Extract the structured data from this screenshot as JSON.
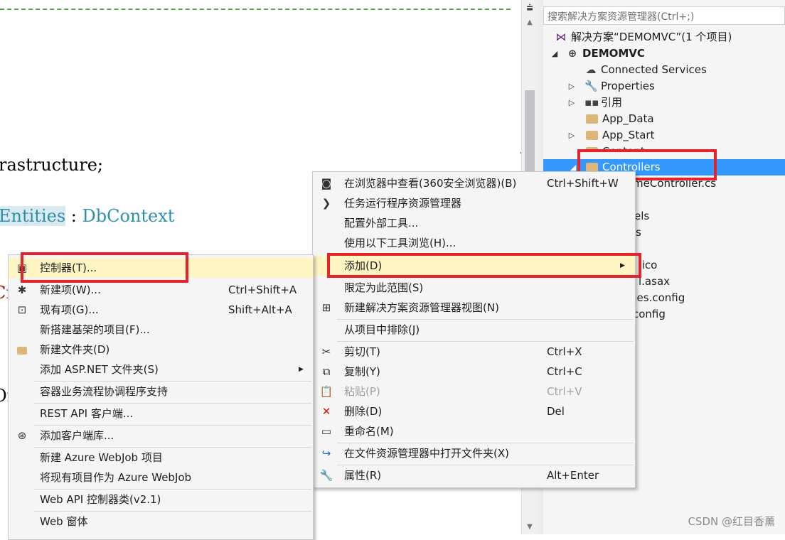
{
  "editor": {
    "line_infra": "rastructure;",
    "line_entities_a": "Entities",
    "line_entities_b": " : ",
    "line_entities_c": "DbContext",
    "frag_cr": "Cr",
    "frag_or": "Or"
  },
  "solution_explorer": {
    "search_placeholder": "搜索解决方案资源管理器(Ctrl+;)",
    "items": [
      {
        "label": "解决方案“DEMOMVC”(1 个项目)"
      },
      {
        "label": "DEMOMVC"
      },
      {
        "label": "Connected Services"
      },
      {
        "label": "Properties"
      },
      {
        "label": "引用"
      },
      {
        "label": "App_Data"
      },
      {
        "label": "App_Start"
      },
      {
        "label": "Content"
      },
      {
        "label": "Controllers"
      },
      {
        "label": "HomeController.cs"
      },
      {
        "label": "Models"
      },
      {
        "label": "Views"
      },
      {
        "label": "favicon.ico"
      },
      {
        "label": "Global.asax"
      },
      {
        "label": "packages.config"
      },
      {
        "label": "Web.config"
      }
    ],
    "partials": [
      "meController.cs",
      "els",
      "s",
      ".ico",
      "l.asax",
      "ges.config",
      "config"
    ]
  },
  "context_menu": {
    "items": [
      {
        "label": "在浏览器中查看(360安全浏览器)(B)",
        "shortcut": "Ctrl+Shift+W"
      },
      {
        "label": "任务运行程序资源管理器",
        "shortcut": ""
      },
      {
        "label": "配置外部工具...",
        "shortcut": ""
      },
      {
        "label": "使用以下工具浏览(H)...",
        "shortcut": ""
      },
      {
        "label": "添加(D)",
        "shortcut": ""
      },
      {
        "label": "限定为此范围(S)",
        "shortcut": ""
      },
      {
        "label": "新建解决方案资源管理器视图(N)",
        "shortcut": ""
      },
      {
        "label": "从项目中排除(J)",
        "shortcut": ""
      },
      {
        "label": "剪切(T)",
        "shortcut": "Ctrl+X"
      },
      {
        "label": "复制(Y)",
        "shortcut": "Ctrl+C"
      },
      {
        "label": "粘贴(P)",
        "shortcut": "Ctrl+V"
      },
      {
        "label": "删除(D)",
        "shortcut": "Del"
      },
      {
        "label": "重命名(M)",
        "shortcut": ""
      },
      {
        "label": "在文件资源管理器中打开文件夹(X)",
        "shortcut": ""
      },
      {
        "label": "属性(R)",
        "shortcut": "Alt+Enter"
      }
    ]
  },
  "add_submenu": {
    "items": [
      {
        "label": "控制器(T)...",
        "shortcut": ""
      },
      {
        "label": "新建项(W)...",
        "shortcut": "Ctrl+Shift+A"
      },
      {
        "label": "现有项(G)...",
        "shortcut": "Shift+Alt+A"
      },
      {
        "label": "新搭建基架的项目(F)...",
        "shortcut": ""
      },
      {
        "label": "新建文件夹(D)",
        "shortcut": ""
      },
      {
        "label": "添加 ASP.NET 文件夹(S)",
        "shortcut": ""
      },
      {
        "label": "容器业务流程协调程序支持",
        "shortcut": ""
      },
      {
        "label": "REST API 客户端...",
        "shortcut": ""
      },
      {
        "label": "添加客户端库...",
        "shortcut": ""
      },
      {
        "label": "新建 Azure WebJob 项目",
        "shortcut": ""
      },
      {
        "label": "将现有项目作为 Azure WebJob",
        "shortcut": ""
      },
      {
        "label": "Web API 控制器类(v2.1)",
        "shortcut": ""
      },
      {
        "label": "Web 窗体",
        "shortcut": ""
      }
    ]
  },
  "watermark": "CSDN @红目香薰",
  "colors": {
    "selection": "#3399ff",
    "highlight_box": "#e8222a",
    "menu_hover": "#fff5c2"
  }
}
